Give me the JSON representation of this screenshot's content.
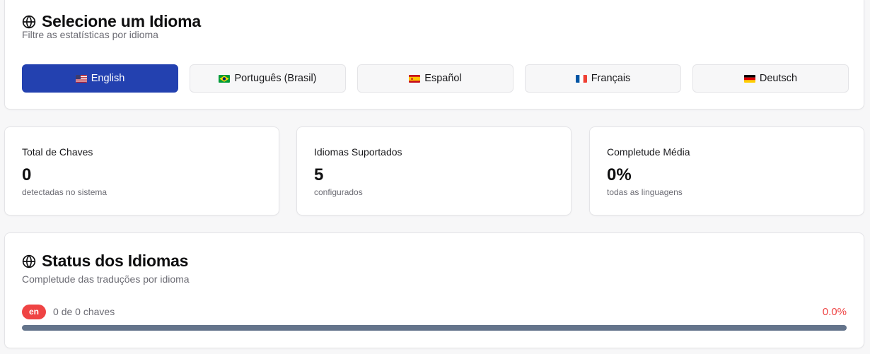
{
  "language_selector": {
    "title": "Selecione um Idioma",
    "subtitle": "Filtre as estatísticas por idioma",
    "icon": "globe-icon",
    "selected": "en",
    "languages": [
      {
        "code": "en",
        "label": "English",
        "flag": "us-flag-icon"
      },
      {
        "code": "pt-BR",
        "label": "Português (Brasil)",
        "flag": "br-flag-icon"
      },
      {
        "code": "es",
        "label": "Español",
        "flag": "es-flag-icon"
      },
      {
        "code": "fr",
        "label": "Français",
        "flag": "fr-flag-icon"
      },
      {
        "code": "de",
        "label": "Deutsch",
        "flag": "de-flag-icon"
      }
    ]
  },
  "stats": [
    {
      "label": "Total de Chaves",
      "value": "0",
      "note": "detectadas no sistema"
    },
    {
      "label": "Idiomas Suportados",
      "value": "5",
      "note": "configurados"
    },
    {
      "label": "Completude Média",
      "value": "0%",
      "note": "todas as linguagens"
    }
  ],
  "status": {
    "title": "Status dos Idiomas",
    "subtitle": "Completude das traduções por idioma",
    "icon": "globe-icon",
    "rows": [
      {
        "badge": "en",
        "keys_text": "0 de 0 chaves",
        "percent_label": "0.0%",
        "progress": 0.0
      }
    ]
  },
  "colors": {
    "accent": "#2341b0",
    "danger": "#ef4444",
    "progress_track": "#64748b",
    "muted_text": "#6b6b73"
  }
}
